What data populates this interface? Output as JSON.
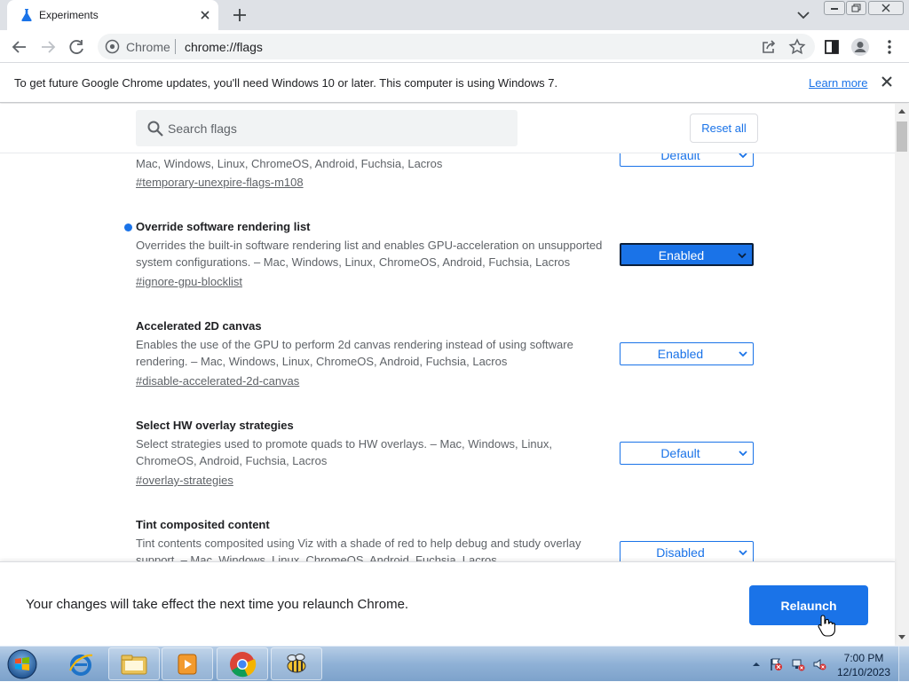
{
  "tab": {
    "title": "Experiments",
    "close_icon": "close-icon"
  },
  "toolbar": {
    "scheme_label": "Chrome",
    "url": "chrome://flags"
  },
  "infobar": {
    "message": "To get future Google Chrome updates, you'll need Windows 10 or later. This computer is using Windows 7.",
    "link_label": "Learn more"
  },
  "search": {
    "placeholder": "Search flags",
    "reset_label": "Reset all"
  },
  "experiments": [
    {
      "title": "",
      "description": "Mac, Windows, Linux, ChromeOS, Android, Fuchsia, Lacros",
      "link": "#temporary-unexpire-flags-m108",
      "value": "Default",
      "modified": false
    },
    {
      "title": "Override software rendering list",
      "description": "Overrides the built-in software rendering list and enables GPU-acceleration on unsupported system configurations. – Mac, Windows, Linux, ChromeOS, Android, Fuchsia, Lacros",
      "link": "#ignore-gpu-blocklist",
      "value": "Enabled",
      "modified": true
    },
    {
      "title": "Accelerated 2D canvas",
      "description": "Enables the use of the GPU to perform 2d canvas rendering instead of using software rendering. – Mac, Windows, Linux, ChromeOS, Android, Fuchsia, Lacros",
      "link": "#disable-accelerated-2d-canvas",
      "value": "Enabled",
      "modified": false
    },
    {
      "title": "Select HW overlay strategies",
      "description": "Select strategies used to promote quads to HW overlays. – Mac, Windows, Linux, ChromeOS, Android, Fuchsia, Lacros",
      "link": "#overlay-strategies",
      "value": "Default",
      "modified": false
    },
    {
      "title": "Tint composited content",
      "description": "Tint contents composited using Viz with a shade of red to help debug and study overlay support. – Mac, Windows, Linux, ChromeOS, Android, Fuchsia, Lacros",
      "link": "",
      "value": "Disabled",
      "modified": false
    }
  ],
  "relaunch": {
    "message": "Your changes will take effect the next time you relaunch Chrome.",
    "button_label": "Relaunch"
  },
  "taskbar": {
    "time": "7:00 PM",
    "date": "12/10/2023",
    "apps": [
      "internet-explorer-icon",
      "file-explorer-icon",
      "media-player-icon",
      "chrome-icon",
      "bee-app-icon"
    ]
  },
  "colors": {
    "accent": "#1a73e8",
    "tabstrip": "#dee1e6",
    "taskbar": "#8fb1d6"
  }
}
